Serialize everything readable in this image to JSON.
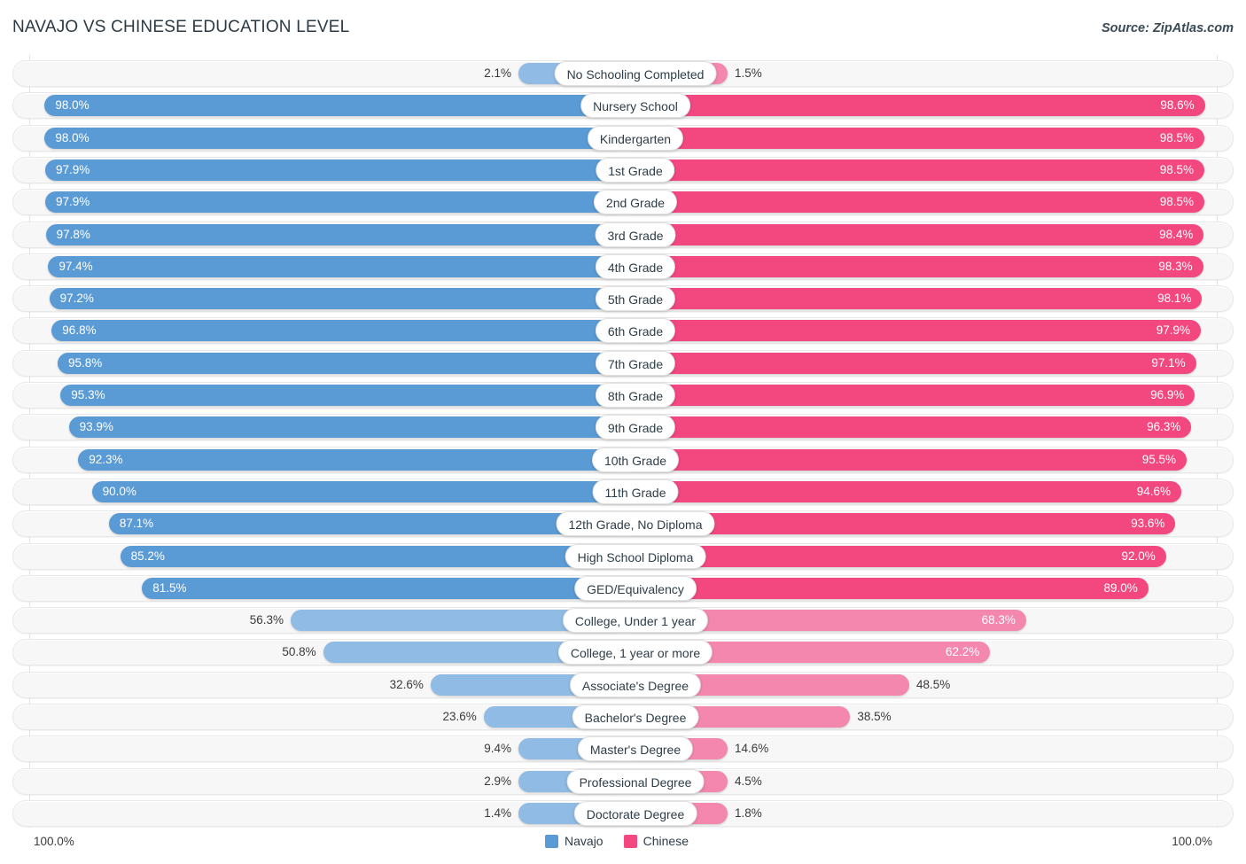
{
  "header": {
    "title": "NAVAJO VS CHINESE EDUCATION LEVEL",
    "source": "Source: ZipAtlas.com"
  },
  "footer": {
    "left_axis_max": "100.0%",
    "right_axis_max": "100.0%",
    "legend": [
      {
        "label": "Navajo",
        "color": "#5b9bd5",
        "name": "legend-navajo"
      },
      {
        "label": "Chinese",
        "color": "#f2477f",
        "name": "legend-chinese"
      }
    ]
  },
  "colors": {
    "navajo": "#5b9bd5",
    "navajo_pale": "#8fbbe4",
    "chinese": "#f2477f",
    "chinese_pale": "#f487ae",
    "track": "#f7f7f7",
    "track_border": "#e8e8e8"
  },
  "chart_data": {
    "type": "bar",
    "title": "NAVAJO VS CHINESE EDUCATION LEVEL",
    "subtitle": "Source: ZipAtlas.com",
    "orientation": "horizontal-diverging",
    "xlabel": "",
    "ylabel": "",
    "xlim": [
      0,
      100
    ],
    "axis_max_label": "100.0%",
    "grid": false,
    "legend_position": "bottom-center",
    "categories": [
      "No Schooling Completed",
      "Nursery School",
      "Kindergarten",
      "1st Grade",
      "2nd Grade",
      "3rd Grade",
      "4th Grade",
      "5th Grade",
      "6th Grade",
      "7th Grade",
      "8th Grade",
      "9th Grade",
      "10th Grade",
      "11th Grade",
      "12th Grade, No Diploma",
      "High School Diploma",
      "GED/Equivalency",
      "College, Under 1 year",
      "College, 1 year or more",
      "Associate's Degree",
      "Bachelor's Degree",
      "Master's Degree",
      "Professional Degree",
      "Doctorate Degree"
    ],
    "series": [
      {
        "name": "Navajo",
        "color": "#5b9bd5",
        "side": "left",
        "values": [
          2.1,
          98.0,
          98.0,
          97.9,
          97.9,
          97.8,
          97.4,
          97.2,
          96.8,
          95.8,
          95.3,
          93.9,
          92.3,
          90.0,
          87.1,
          85.2,
          81.5,
          56.3,
          50.8,
          32.6,
          23.6,
          9.4,
          2.9,
          1.4
        ],
        "labels": [
          "2.1%",
          "98.0%",
          "98.0%",
          "97.9%",
          "97.9%",
          "97.8%",
          "97.4%",
          "97.2%",
          "96.8%",
          "95.8%",
          "95.3%",
          "93.9%",
          "92.3%",
          "90.0%",
          "87.1%",
          "85.2%",
          "81.5%",
          "56.3%",
          "50.8%",
          "32.6%",
          "23.6%",
          "9.4%",
          "2.9%",
          "1.4%"
        ]
      },
      {
        "name": "Chinese",
        "color": "#f2477f",
        "side": "right",
        "values": [
          1.5,
          98.6,
          98.5,
          98.5,
          98.5,
          98.4,
          98.3,
          98.1,
          97.9,
          97.1,
          96.9,
          96.3,
          95.5,
          94.6,
          93.6,
          92.0,
          89.0,
          68.3,
          62.2,
          48.5,
          38.5,
          14.6,
          4.5,
          1.8
        ],
        "labels": [
          "1.5%",
          "98.6%",
          "98.5%",
          "98.5%",
          "98.5%",
          "98.4%",
          "98.3%",
          "98.1%",
          "97.9%",
          "97.1%",
          "96.9%",
          "96.3%",
          "95.5%",
          "94.6%",
          "93.6%",
          "92.0%",
          "89.0%",
          "68.3%",
          "62.2%",
          "48.5%",
          "38.5%",
          "14.6%",
          "4.5%",
          "1.8%"
        ]
      }
    ]
  }
}
